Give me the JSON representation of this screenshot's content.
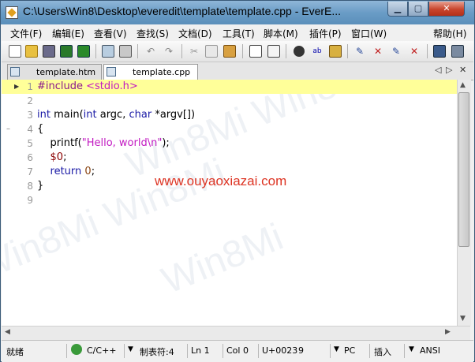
{
  "window": {
    "title": "C:\\Users\\Win8\\Desktop\\everedit\\template\\template.cpp - EverE..."
  },
  "menu": [
    "文件(F)",
    "编辑(E)",
    "查看(V)",
    "查找(S)",
    "文档(D)",
    "工具(T)",
    "脚本(M)",
    "插件(P)",
    "窗口(W)",
    "帮助(H)"
  ],
  "tabs": [
    {
      "label": "template.htm",
      "active": false
    },
    {
      "label": "template.cpp",
      "active": true
    }
  ],
  "editor": {
    "current_line": 1,
    "lines": [
      "1",
      "2",
      "3",
      "4",
      "5",
      "6",
      "7",
      "8",
      "9"
    ]
  },
  "code": {
    "l1_directive": "#include",
    "l1_header": "<stdio.h>",
    "l3_int": "int",
    "l3_main": " main(",
    "l3_int2": "int",
    "l3_argc": " argc, ",
    "l3_char": "char",
    "l3_rest": " *argv[])",
    "l4": "{",
    "l5_pre": "    printf(",
    "l5_str": "\"Hello, world\\n\"",
    "l5_post": ");",
    "l6_pre": "    ",
    "l6_var": "$0",
    "l6_post": ";",
    "l7_pre": "    ",
    "l7_kw": "return",
    "l7_sp": " ",
    "l7_num": "0",
    "l7_post": ";",
    "l8": "}"
  },
  "overlay_text": "www.ouyaoxiazai.com",
  "status": {
    "ready": "就绪",
    "syntax": "C/C++",
    "tab": "制表符:4",
    "line": "Ln 1",
    "col": "Col 0",
    "char": "U+0023",
    "char_dec": "9",
    "eol": "PC",
    "mode": "插入",
    "encoding": "ANSI"
  }
}
